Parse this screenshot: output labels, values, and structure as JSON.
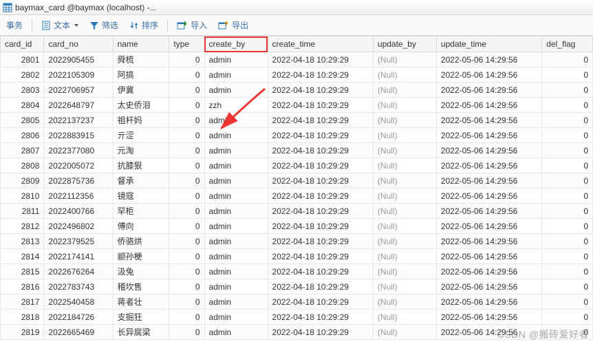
{
  "window": {
    "title": "baymax_card @baymax (localhost) -..."
  },
  "toolbar": {
    "transaction": "事务",
    "text": "文本",
    "filter": "筛选",
    "sort": "排序",
    "import": "导入",
    "export": "导出"
  },
  "columns": [
    "card_id",
    "card_no",
    "name",
    "type",
    "create_by",
    "create_time",
    "update_by",
    "update_time",
    "del_flag"
  ],
  "highlight_col": "create_by",
  "rows": [
    {
      "card_id": 2801,
      "card_no": "2022905455",
      "name": "舜梳",
      "type": 0,
      "create_by": "admin",
      "create_time": "2022-04-18 10:29:29",
      "update_by": "(Null)",
      "update_time": "2022-05-06 14:29:56",
      "del_flag": 0
    },
    {
      "card_id": 2802,
      "card_no": "2022105309",
      "name": "阿搞",
      "type": 0,
      "create_by": "admin",
      "create_time": "2022-04-18 10:29:29",
      "update_by": "(Null)",
      "update_time": "2022-05-06 14:29:56",
      "del_flag": 0
    },
    {
      "card_id": 2803,
      "card_no": "2022706957",
      "name": "伊冀",
      "type": 0,
      "create_by": "admin",
      "create_time": "2022-04-18 10:29:29",
      "update_by": "(Null)",
      "update_time": "2022-05-06 14:29:56",
      "del_flag": 0
    },
    {
      "card_id": 2804,
      "card_no": "2022648797",
      "name": "太史侨泪",
      "type": 0,
      "create_by": "zzh",
      "create_time": "2022-04-18 10:29:29",
      "update_by": "(Null)",
      "update_time": "2022-05-06 14:29:56",
      "del_flag": 0
    },
    {
      "card_id": 2805,
      "card_no": "2022137237",
      "name": "祖杆妈",
      "type": 0,
      "create_by": "admin",
      "create_time": "2022-04-18 10:29:29",
      "update_by": "(Null)",
      "update_time": "2022-05-06 14:29:56",
      "del_flag": 0
    },
    {
      "card_id": 2806,
      "card_no": "2022883915",
      "name": "亓涩",
      "type": 0,
      "create_by": "admin",
      "create_time": "2022-04-18 10:29:29",
      "update_by": "(Null)",
      "update_time": "2022-05-06 14:29:56",
      "del_flag": 0
    },
    {
      "card_id": 2807,
      "card_no": "2022377080",
      "name": "元淘",
      "type": 0,
      "create_by": "admin",
      "create_time": "2022-04-18 10:29:29",
      "update_by": "(Null)",
      "update_time": "2022-05-06 14:29:56",
      "del_flag": 0
    },
    {
      "card_id": 2808,
      "card_no": "2022005072",
      "name": "抗膝狠",
      "type": 0,
      "create_by": "admin",
      "create_time": "2022-04-18 10:29:29",
      "update_by": "(Null)",
      "update_time": "2022-05-06 14:29:56",
      "del_flag": 0
    },
    {
      "card_id": 2809,
      "card_no": "2022875736",
      "name": "督承",
      "type": 0,
      "create_by": "admin",
      "create_time": "2022-04-18 10:29:29",
      "update_by": "(Null)",
      "update_time": "2022-05-06 14:29:56",
      "del_flag": 0
    },
    {
      "card_id": 2810,
      "card_no": "2022112356",
      "name": "镜寇",
      "type": 0,
      "create_by": "admin",
      "create_time": "2022-04-18 10:29:29",
      "update_by": "(Null)",
      "update_time": "2022-05-06 14:29:56",
      "del_flag": 0
    },
    {
      "card_id": 2811,
      "card_no": "2022400766",
      "name": "罕柜",
      "type": 0,
      "create_by": "admin",
      "create_time": "2022-04-18 10:29:29",
      "update_by": "(Null)",
      "update_time": "2022-05-06 14:29:56",
      "del_flag": 0
    },
    {
      "card_id": 2812,
      "card_no": "2022496802",
      "name": "傅向",
      "type": 0,
      "create_by": "admin",
      "create_time": "2022-04-18 10:29:29",
      "update_by": "(Null)",
      "update_time": "2022-05-06 14:29:56",
      "del_flag": 0
    },
    {
      "card_id": 2813,
      "card_no": "2022379525",
      "name": "侨骆烘",
      "type": 0,
      "create_by": "admin",
      "create_time": "2022-04-18 10:29:29",
      "update_by": "(Null)",
      "update_time": "2022-05-06 14:29:56",
      "del_flag": 0
    },
    {
      "card_id": 2814,
      "card_no": "2022174141",
      "name": "颛孙梗",
      "type": 0,
      "create_by": "admin",
      "create_time": "2022-04-18 10:29:29",
      "update_by": "(Null)",
      "update_time": "2022-05-06 14:29:56",
      "del_flag": 0
    },
    {
      "card_id": 2815,
      "card_no": "2022676264",
      "name": "汲兔",
      "type": 0,
      "create_by": "admin",
      "create_time": "2022-04-18 10:29:29",
      "update_by": "(Null)",
      "update_time": "2022-05-06 14:29:56",
      "del_flag": 0
    },
    {
      "card_id": 2816,
      "card_no": "2022783743",
      "name": "稽坎售",
      "type": 0,
      "create_by": "admin",
      "create_time": "2022-04-18 10:29:29",
      "update_by": "(Null)",
      "update_time": "2022-05-06 14:29:56",
      "del_flag": 0
    },
    {
      "card_id": 2817,
      "card_no": "2022540458",
      "name": "蒋者壮",
      "type": 0,
      "create_by": "admin",
      "create_time": "2022-04-18 10:29:29",
      "update_by": "(Null)",
      "update_time": "2022-05-06 14:29:56",
      "del_flag": 0
    },
    {
      "card_id": 2818,
      "card_no": "2022184726",
      "name": "支掘狂",
      "type": 0,
      "create_by": "admin",
      "create_time": "2022-04-18 10:29:29",
      "update_by": "(Null)",
      "update_time": "2022-05-06 14:29:56",
      "del_flag": 0
    },
    {
      "card_id": 2819,
      "card_no": "2022665469",
      "name": "长异腐梁",
      "type": 0,
      "create_by": "admin",
      "create_time": "2022-04-18 10:29:29",
      "update_by": "(Null)",
      "update_time": "2022-05-06 14:29:56",
      "del_flag": 0
    }
  ],
  "watermark": "CSDN @搬砖爱好者"
}
